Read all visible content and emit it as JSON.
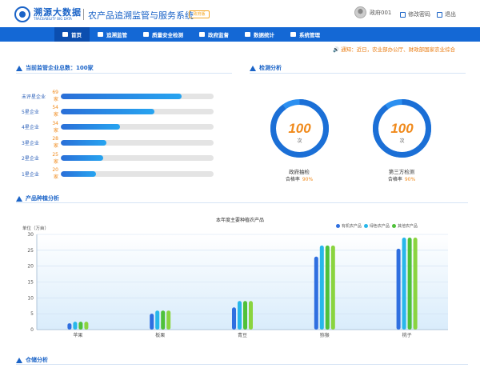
{
  "header": {
    "logo_cn": "溯源大数据",
    "logo_en": "TRACEABILITY BIG DATA",
    "system_title": "农产品追溯监管与服务系统",
    "role_badge": "政府版",
    "user_name": "政府001",
    "change_password": "修改密码",
    "logout": "退出"
  },
  "nav": {
    "items": [
      {
        "label": "首页",
        "icon": "home-icon",
        "active": true
      },
      {
        "label": "追溯监管",
        "icon": "grid-icon"
      },
      {
        "label": "质量安全检测",
        "icon": "shield-icon"
      },
      {
        "label": "政府监督",
        "icon": "building-icon"
      },
      {
        "label": "数据统计",
        "icon": "chart-icon"
      },
      {
        "label": "系统管理",
        "icon": "gear-icon"
      }
    ]
  },
  "notice": "通知：近日，农业部办公厅、财政部国家农业综合",
  "enterprise_section": {
    "title": "当前监管企业总数：100家",
    "rows": [
      {
        "label": "未评星企业",
        "count": "69家",
        "fraction": 0.79
      },
      {
        "label": "5星企业",
        "count": "54家",
        "fraction": 0.61
      },
      {
        "label": "4星企业",
        "count": "34家",
        "fraction": 0.39
      },
      {
        "label": "3星企业",
        "count": "28家",
        "fraction": 0.3
      },
      {
        "label": "2星企业",
        "count": "25家",
        "fraction": 0.28
      },
      {
        "label": "1星企业",
        "count": "20家",
        "fraction": 0.23
      }
    ]
  },
  "inspection_section": {
    "title": "检测分析",
    "rings": [
      {
        "value": "100",
        "unit": "次",
        "label": "政府抽检",
        "rate_label": "合格率",
        "rate_value": "90%",
        "fraction": 0.9
      },
      {
        "value": "100",
        "unit": "次",
        "label": "第三方检测",
        "rate_label": "合格率",
        "rate_value": "90%",
        "fraction": 0.9
      }
    ]
  },
  "planting_section": {
    "title": "产品种植分析"
  },
  "warehouse_section": {
    "title": "仓储分析"
  },
  "chart_data": {
    "type": "bar",
    "title": "本年度主要种植农产品",
    "ylabel": "单位（万亩）",
    "ylim": [
      0,
      30
    ],
    "yticks": [
      0,
      5,
      10,
      15,
      20,
      25,
      30
    ],
    "categories": [
      "苹果",
      "板栗",
      "青豆",
      "猕猴",
      "桃子"
    ],
    "legend_position": "top-right",
    "series": [
      {
        "name": "有机农产品",
        "color": "#2f6fe0",
        "values": [
          2,
          5,
          7,
          23,
          25.5
        ]
      },
      {
        "name": "绿色农产品",
        "color": "#28b7ea",
        "values": [
          2.5,
          6,
          9,
          26.5,
          29
        ]
      },
      {
        "name": "其他农产品",
        "color": "#4fc13a",
        "values": [
          2.5,
          6,
          9,
          26.5,
          29
        ]
      },
      {
        "values": [
          2.5,
          6,
          9,
          26.5,
          29
        ]
      }
    ]
  }
}
